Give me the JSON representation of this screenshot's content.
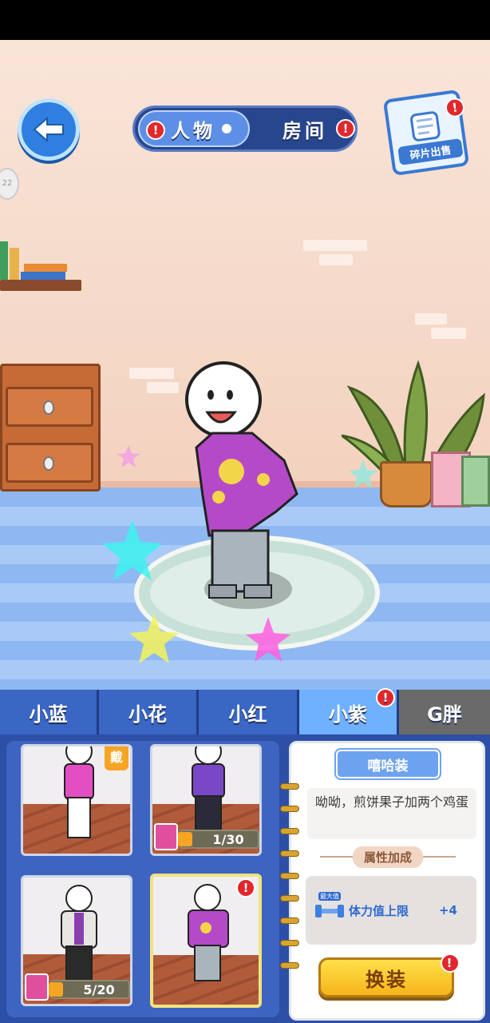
{
  "top_nav": {
    "tab_character": "人物",
    "tab_room": "房间",
    "sell_fragments_label": "碎片出售",
    "badge_mark": "!"
  },
  "side_chip": "22",
  "character_tabs": [
    {
      "label": "小蓝",
      "active": false
    },
    {
      "label": "小花",
      "active": false
    },
    {
      "label": "小红",
      "active": false
    },
    {
      "label": "小紫",
      "active": true,
      "badge": true
    },
    {
      "label": "G胖",
      "active": false
    }
  ],
  "outfits": [
    {
      "wear_tag": "戴",
      "progress": ""
    },
    {
      "progress": "1/30"
    },
    {
      "progress": "5/20"
    },
    {
      "progress": "",
      "selected": true,
      "badge": true
    }
  ],
  "detail": {
    "outfit_name": "嘻哈装",
    "description": "呦呦，煎饼果子加两个鸡蛋",
    "attr_header": "属性加成",
    "attr_icon_tag": "最大值",
    "attr_name": "体力值上限",
    "attr_value": "+4",
    "equip_button": "换装"
  },
  "colors": {
    "tab_active": "#6fb0ff",
    "tab_inactive": "#3a66c4",
    "badge_red": "#e1282c",
    "equip_yellow": "#ffd23a"
  }
}
